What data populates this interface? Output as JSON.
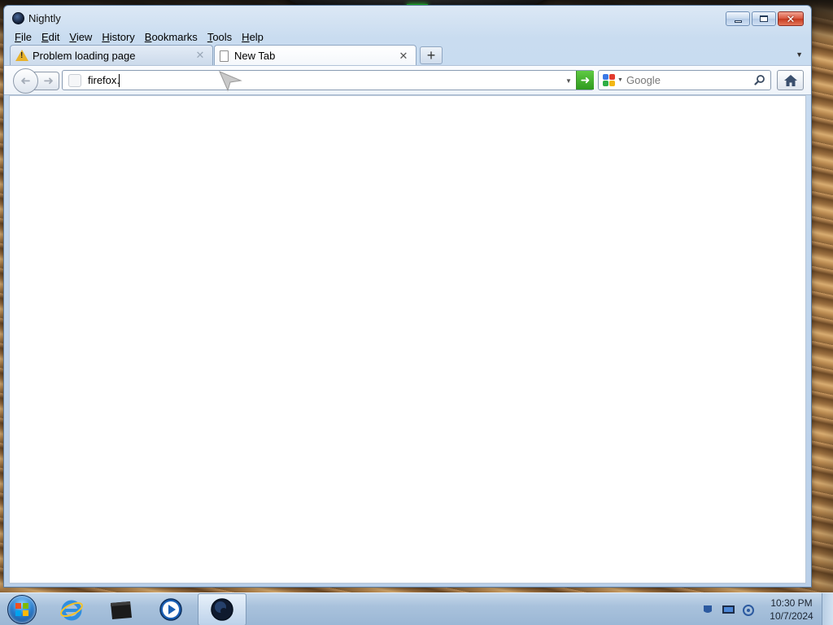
{
  "window": {
    "title": "Nightly"
  },
  "menubar": {
    "items": [
      "File",
      "Edit",
      "View",
      "History",
      "Bookmarks",
      "Tools",
      "Help"
    ]
  },
  "tabs": [
    {
      "label": "Problem loading page",
      "icon": "warning-icon",
      "selected": false,
      "close": "✕"
    },
    {
      "label": "New Tab",
      "icon": "page-icon",
      "selected": true,
      "close": "✕"
    }
  ],
  "tabstrip": {
    "new_tab": "+",
    "list_tabs": "▼"
  },
  "navbar": {
    "url_value": "firefox.",
    "search_placeholder": "Google",
    "go_arrow": "➜"
  },
  "taskbar": {
    "items": [
      "internet-explorer-icon",
      "file-explorer-icon",
      "media-player-icon",
      "nightly-icon"
    ],
    "active_item": "nightly-icon"
  },
  "clock": {
    "time": "10:30 PM",
    "date": "10/7/2024"
  },
  "colors": {
    "accent_go": "#3db12a",
    "close_button": "#d7553c",
    "taskbar": "#a9c2dc"
  }
}
